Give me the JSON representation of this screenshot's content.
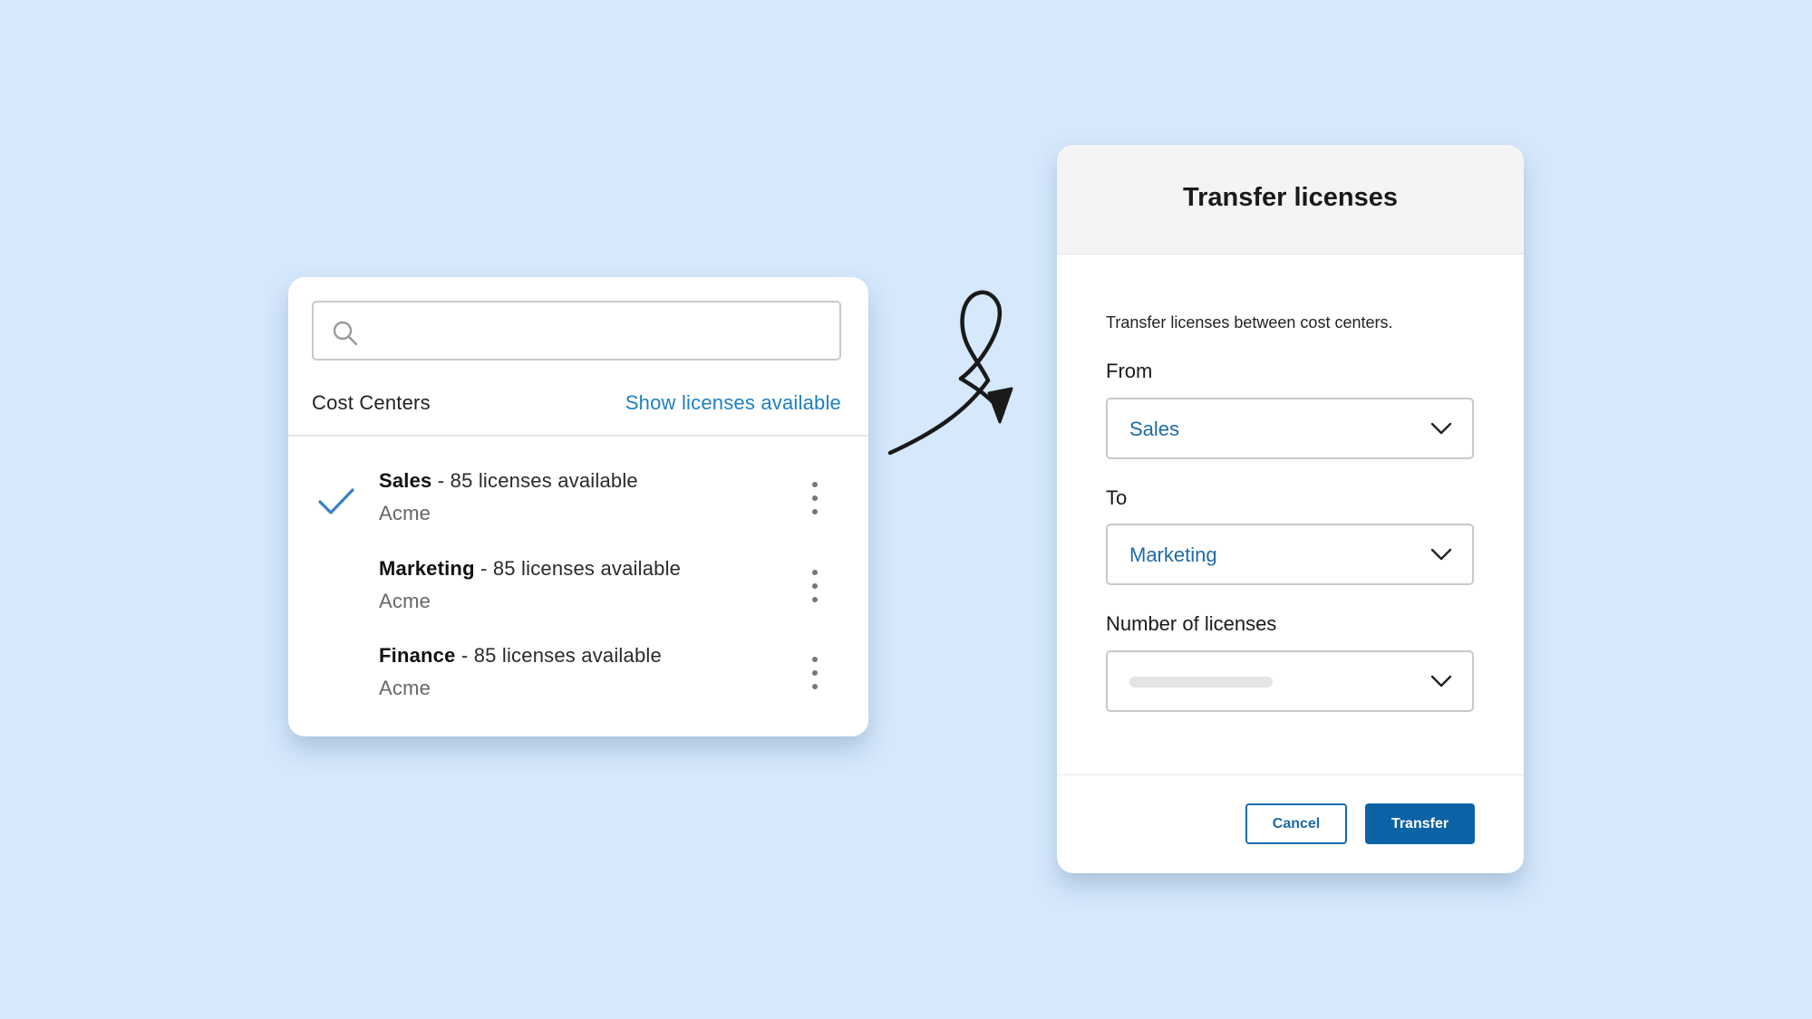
{
  "cost_centers_card": {
    "search": {
      "value": "",
      "placeholder": ""
    },
    "title": "Cost Centers",
    "show_licenses_link": "Show licenses available",
    "items": [
      {
        "name": "Sales",
        "detail": " - 85 licenses available",
        "org": "Acme",
        "selected": true
      },
      {
        "name": "Marketing",
        "detail": " - 85 licenses available",
        "org": "Acme",
        "selected": false
      },
      {
        "name": "Finance",
        "detail": " - 85 licenses available",
        "org": "Acme",
        "selected": false
      }
    ]
  },
  "transfer_modal": {
    "title": "Transfer licenses",
    "description": "Transfer licenses between cost centers.",
    "from_label": "From",
    "from_value": "Sales",
    "to_label": "To",
    "to_value": "Marketing",
    "number_label": "Number of licenses",
    "number_value": "",
    "cancel_label": "Cancel",
    "transfer_label": "Transfer"
  },
  "colors": {
    "background": "#d5e8fc",
    "accent": "#1e7fc1",
    "primary_button": "#0b63a5",
    "check": "#3b7fc0"
  },
  "icons": {
    "search": "search-icon",
    "check": "check-icon",
    "more": "kebab-menu-icon",
    "dropdown": "chevron-down-icon",
    "arrow": "hand-drawn-arrow-icon"
  }
}
